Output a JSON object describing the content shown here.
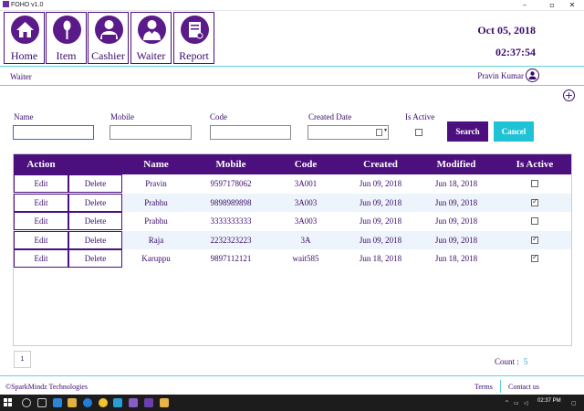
{
  "window": {
    "title": "FOHO v1.0",
    "minimize_glyph": "–",
    "maximize_glyph": "▫",
    "close_glyph": "✕"
  },
  "nav": [
    {
      "label": "Home",
      "icon": "home-icon"
    },
    {
      "label": "Item",
      "icon": "fork-spoon-icon"
    },
    {
      "label": "Cashier",
      "icon": "cashier-icon"
    },
    {
      "label": "Waiter",
      "icon": "waiter-icon"
    },
    {
      "label": "Report",
      "icon": "report-icon"
    }
  ],
  "header": {
    "date": "Oct 05, 2018",
    "time": "02:37:54",
    "breadcrumb": "Waiter",
    "user_name": "Pravin Kumar"
  },
  "filters": {
    "name_label": "Name",
    "name_value": "",
    "mobile_label": "Mobile",
    "mobile_value": "",
    "code_label": "Code",
    "code_value": "",
    "created_date_label": "Created Date",
    "created_date_value": "",
    "is_active_label": "Is Active",
    "is_active_checked": false,
    "search_label": "Search",
    "cancel_label": "Cancel"
  },
  "table": {
    "headers": {
      "action": "Action",
      "name": "Name",
      "mobile": "Mobile",
      "code": "Code",
      "created": "Created",
      "modified": "Modified",
      "is_active": "Is Active"
    },
    "edit_label": "Edit",
    "delete_label": "Delete",
    "rows": [
      {
        "name": "Pravin",
        "mobile": "9597178062",
        "code": "3A001",
        "created": "Jun 09, 2018",
        "modified": "Jun 18, 2018",
        "is_active": false
      },
      {
        "name": "Prabhu",
        "mobile": "9898989898",
        "code": "3A003",
        "created": "Jun 09, 2018",
        "modified": "Jun 09, 2018",
        "is_active": true
      },
      {
        "name": "Prabhu",
        "mobile": "3333333333",
        "code": "3A003",
        "created": "Jun 09, 2018",
        "modified": "Jun 09, 2018",
        "is_active": false
      },
      {
        "name": "Raja",
        "mobile": "2232323223",
        "code": "3A",
        "created": "Jun 09, 2018",
        "modified": "Jun 09, 2018",
        "is_active": true
      },
      {
        "name": "Karuppu",
        "mobile": "9897112121",
        "code": "wait585",
        "created": "Jun 18, 2018",
        "modified": "Jun 18, 2018",
        "is_active": true
      }
    ]
  },
  "pager": {
    "current_page": "1"
  },
  "count": {
    "label": "Count :",
    "value": "5"
  },
  "footer": {
    "copyright": "©SparkMindz Technologies",
    "terms": "Terms",
    "contact": "Contact us"
  },
  "taskbar": {
    "time": "02:37 PM"
  },
  "colors": {
    "primary": "#4b0f7e",
    "accent": "#20c2d6",
    "text": "#3a0a6b",
    "row_alt": "#eef4fb"
  }
}
